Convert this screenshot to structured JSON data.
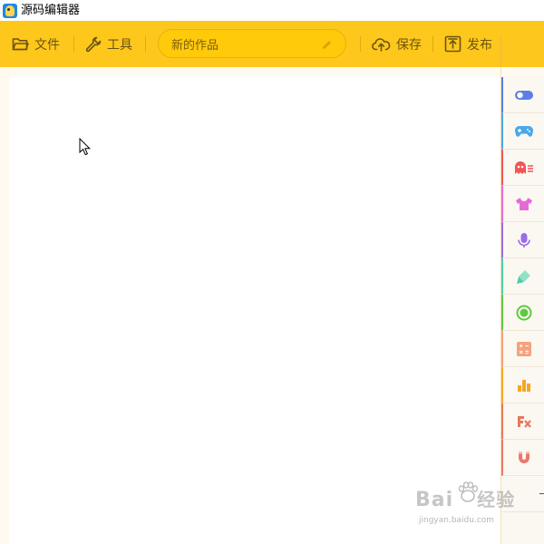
{
  "window": {
    "title": "源码编辑器"
  },
  "toolbar": {
    "file_label": "文件",
    "tools_label": "工具",
    "project_name": "新的作品",
    "save_label": "保存",
    "publish_label": "发布",
    "background_color": "#fec71c"
  },
  "palette": {
    "categories": [
      {
        "icon": "toggle-icon",
        "color": "#5b7fe6"
      },
      {
        "icon": "gamepad-icon",
        "color": "#4aa9e8"
      },
      {
        "icon": "ghost-icon",
        "color": "#f15555"
      },
      {
        "icon": "tshirt-icon",
        "color": "#e56ad8"
      },
      {
        "icon": "microphone-icon",
        "color": "#9b6ce8"
      },
      {
        "icon": "pen-icon",
        "color": "#4ccfa8"
      },
      {
        "icon": "circle-icon",
        "color": "#5fc942"
      },
      {
        "icon": "calculator-icon",
        "color": "#f4a27d"
      },
      {
        "icon": "bar-chart-icon",
        "color": "#f6a623"
      },
      {
        "icon": "function-icon",
        "color": "#e8775f"
      },
      {
        "icon": "magnet-icon",
        "color": "#e87a6a"
      }
    ]
  },
  "watermark": {
    "brand": "Bai",
    "brand_cn": "经验",
    "url": "jingyan.baidu.com"
  }
}
